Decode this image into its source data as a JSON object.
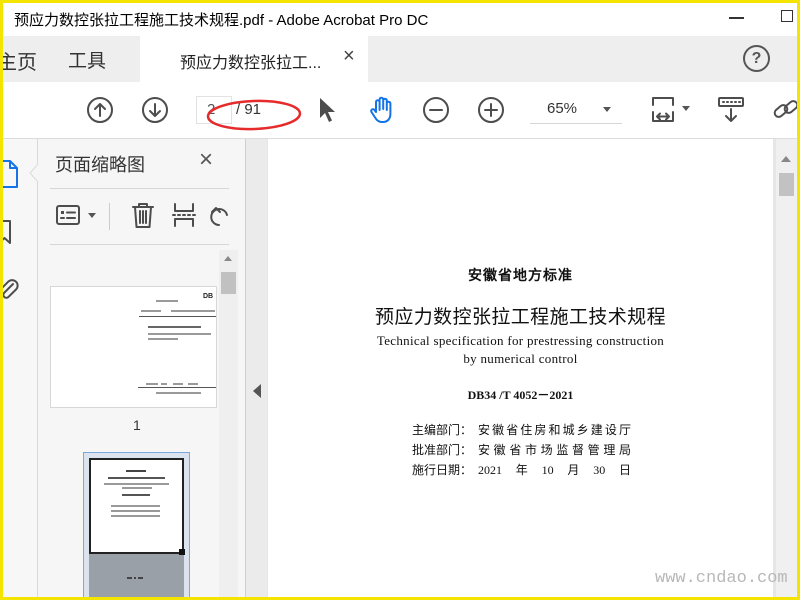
{
  "window": {
    "title": "预应力数控张拉工程施工技术规程.pdf - Adobe Acrobat Pro DC"
  },
  "tabs": {
    "home": "主页",
    "tools": "工具",
    "document_tab": "预应力数控张拉工...",
    "document_tab_close": "×",
    "help": "?"
  },
  "toolbar": {
    "current_page": "2",
    "page_total": "/ 91",
    "zoom": "65%"
  },
  "thumbnail_panel": {
    "title": "页面缩略图",
    "close": "×",
    "thumbnails": [
      {
        "page_label": "1",
        "cover_mark": "DB",
        "selected": false
      },
      {
        "selected": true
      }
    ]
  },
  "document": {
    "header": "安徽省地方标准",
    "title": "预应力数控张拉工程施工技术规程",
    "subtitle_en": [
      "Technical specification for prestressing construction",
      "by numerical control"
    ],
    "code": "DB34 /T 4052－2021",
    "info": [
      {
        "label": "主编部门：",
        "value": "安徽省住房和城乡建设厅"
      },
      {
        "label": "批准部门：",
        "value": "安徽省市场监督管理局"
      },
      {
        "label": "施行日期：",
        "value": "2021年10月30日"
      }
    ]
  },
  "watermark": "www.cndao.com",
  "icons": {
    "toolbar": [
      "arrow-up-circle-icon",
      "arrow-down-circle-icon",
      "select-pointer-icon",
      "hand-tool-icon",
      "zoom-out-icon",
      "zoom-in-icon",
      "fit-page-icon",
      "scroll-mode-icon",
      "link-icon"
    ],
    "sidebar": [
      "page-thumbnails-icon",
      "bookmark-icon",
      "paperclip-icon"
    ],
    "panel_tools": [
      "thumbnail-options-icon",
      "trash-icon",
      "insert-pages-icon",
      "rotate-icon"
    ]
  },
  "colors": {
    "accent_blue": "#1473e6",
    "annotation_red": "#e52b2b",
    "frame_yellow": "#f3e500"
  }
}
